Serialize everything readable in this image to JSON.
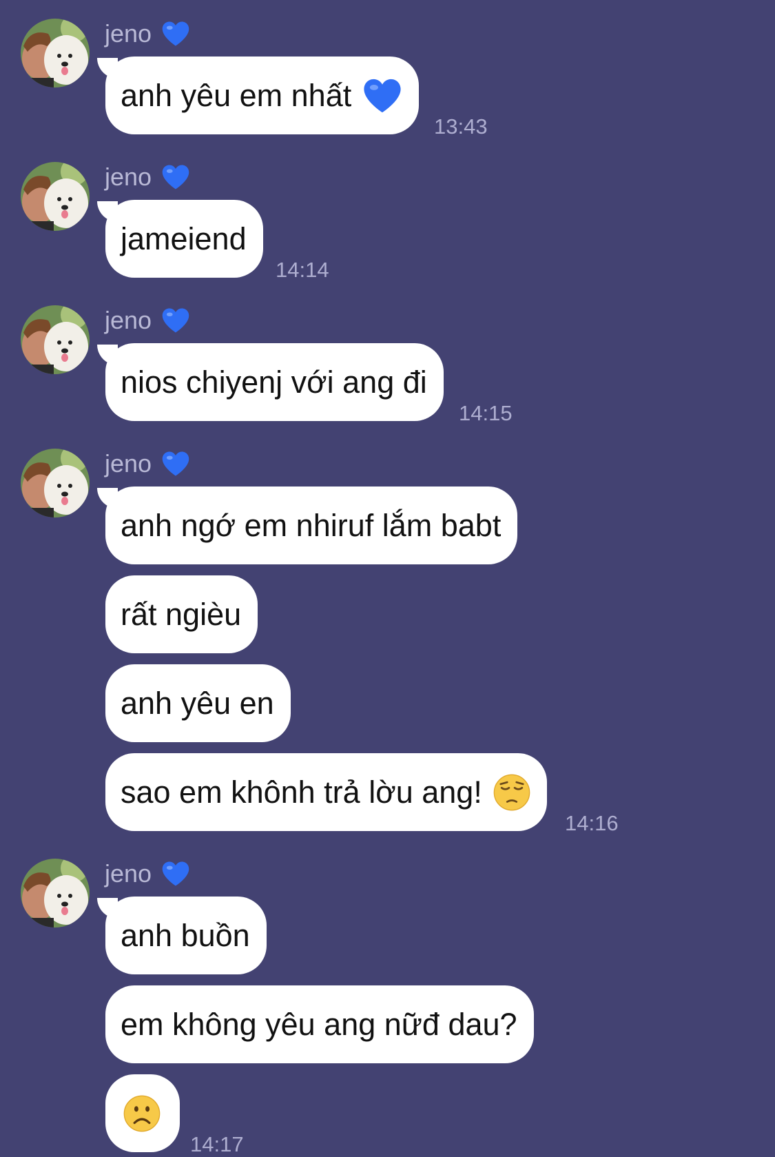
{
  "sender_name": "jeno",
  "colors": {
    "background": "#434272",
    "bubble": "#ffffff",
    "heart": "#2f6ef5"
  },
  "groups": [
    {
      "sender": "jeno",
      "messages": [
        "anh yêu em nhất"
      ],
      "time": "13:43"
    },
    {
      "sender": "jeno",
      "messages": [
        "jameiend"
      ],
      "time": "14:14"
    },
    {
      "sender": "jeno",
      "messages": [
        "nios chiyenj với ang đi"
      ],
      "time": "14:15"
    },
    {
      "sender": "jeno",
      "messages": [
        "anh ngớ em nhiruf lắm babt",
        "rất ngièu",
        "anh yêu en",
        "sao em khônh trả lờu ang!"
      ],
      "time": "14:16"
    },
    {
      "sender": "jeno",
      "messages": [
        "anh buồn",
        "em không yêu ang nữđ dau?",
        ""
      ],
      "time": "14:17"
    }
  ],
  "icons": {
    "heart": "blue-heart-icon",
    "pensive": "pensive-face-icon",
    "frown": "frowning-face-icon",
    "avatar": "avatar-person-with-dog"
  }
}
